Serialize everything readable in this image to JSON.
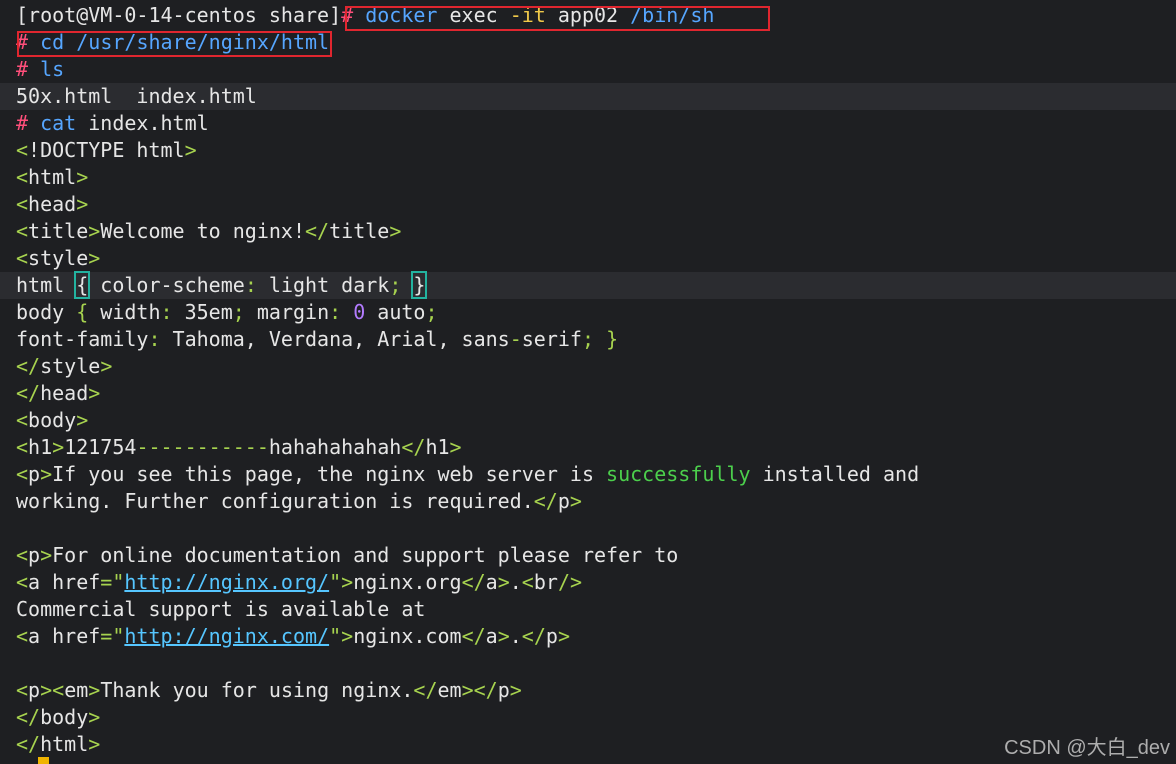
{
  "terminal": {
    "lines": [
      {
        "segments": [
          {
            "t": "[root@VM-0-14-centos share]",
            "c": "prompt"
          },
          {
            "t": "# ",
            "c": "hash"
          },
          {
            "t": "docker",
            "c": "cmd"
          },
          {
            "t": " exec ",
            "c": "plain"
          },
          {
            "t": "-it",
            "c": "arg"
          },
          {
            "t": " app02 ",
            "c": "plain"
          },
          {
            "t": "/bin/sh",
            "c": "cmd"
          }
        ]
      },
      {
        "segments": [
          {
            "t": "# ",
            "c": "hash"
          },
          {
            "t": "cd",
            "c": "cmd"
          },
          {
            "t": " ",
            "c": "plain"
          },
          {
            "t": "/usr/share/nginx/html",
            "c": "cmd"
          }
        ]
      },
      {
        "segments": [
          {
            "t": "# ",
            "c": "hash"
          },
          {
            "t": "ls",
            "c": "cmd"
          }
        ]
      },
      {
        "highlight": true,
        "segments": [
          {
            "t": "50x.html  index.html",
            "c": "plain"
          }
        ]
      },
      {
        "segments": [
          {
            "t": "# ",
            "c": "hash"
          },
          {
            "t": "cat",
            "c": "cmd"
          },
          {
            "t": " index.html",
            "c": "plain"
          }
        ]
      },
      {
        "segments": [
          {
            "t": "<",
            "c": "tag"
          },
          {
            "t": "!DOCTYPE html",
            "c": "plain"
          },
          {
            "t": ">",
            "c": "tag"
          }
        ]
      },
      {
        "segments": [
          {
            "t": "<",
            "c": "tag"
          },
          {
            "t": "html",
            "c": "plain"
          },
          {
            "t": ">",
            "c": "tag"
          }
        ]
      },
      {
        "segments": [
          {
            "t": "<",
            "c": "tag"
          },
          {
            "t": "head",
            "c": "plain"
          },
          {
            "t": ">",
            "c": "tag"
          }
        ]
      },
      {
        "segments": [
          {
            "t": "<",
            "c": "tag"
          },
          {
            "t": "title",
            "c": "plain"
          },
          {
            "t": ">",
            "c": "tag"
          },
          {
            "t": "Welcome to nginx!",
            "c": "plain"
          },
          {
            "t": "</",
            "c": "tag"
          },
          {
            "t": "title",
            "c": "plain"
          },
          {
            "t": ">",
            "c": "tag"
          }
        ]
      },
      {
        "segments": [
          {
            "t": "<",
            "c": "tag"
          },
          {
            "t": "style",
            "c": "plain"
          },
          {
            "t": ">",
            "c": "tag"
          }
        ]
      },
      {
        "highlight": true,
        "segments": [
          {
            "t": "html ",
            "c": "plain"
          },
          {
            "t": "{",
            "c": "bracket"
          },
          {
            "t": " color-scheme",
            "c": "plain"
          },
          {
            "t": ":",
            "c": "tag"
          },
          {
            "t": " light dark",
            "c": "plain"
          },
          {
            "t": ";",
            "c": "tag"
          },
          {
            "t": " ",
            "c": "plain"
          },
          {
            "t": "}",
            "c": "bracket"
          }
        ]
      },
      {
        "segments": [
          {
            "t": "body ",
            "c": "plain"
          },
          {
            "t": "{",
            "c": "tag"
          },
          {
            "t": " width",
            "c": "plain"
          },
          {
            "t": ":",
            "c": "tag"
          },
          {
            "t": " 35em",
            "c": "plain"
          },
          {
            "t": ";",
            "c": "tag"
          },
          {
            "t": " margin",
            "c": "plain"
          },
          {
            "t": ":",
            "c": "tag"
          },
          {
            "t": " ",
            "c": "plain"
          },
          {
            "t": "0",
            "c": "num"
          },
          {
            "t": " auto",
            "c": "plain"
          },
          {
            "t": ";",
            "c": "tag"
          }
        ]
      },
      {
        "segments": [
          {
            "t": "font-family",
            "c": "plain"
          },
          {
            "t": ":",
            "c": "tag"
          },
          {
            "t": " Tahoma, Verdana, Arial, sans",
            "c": "plain"
          },
          {
            "t": "-",
            "c": "tag"
          },
          {
            "t": "serif",
            "c": "plain"
          },
          {
            "t": ";",
            "c": "tag"
          },
          {
            "t": " ",
            "c": "plain"
          },
          {
            "t": "}",
            "c": "tag"
          }
        ]
      },
      {
        "segments": [
          {
            "t": "</",
            "c": "tag"
          },
          {
            "t": "style",
            "c": "plain"
          },
          {
            "t": ">",
            "c": "tag"
          }
        ]
      },
      {
        "segments": [
          {
            "t": "</",
            "c": "tag"
          },
          {
            "t": "head",
            "c": "plain"
          },
          {
            "t": ">",
            "c": "tag"
          }
        ]
      },
      {
        "segments": [
          {
            "t": "<",
            "c": "tag"
          },
          {
            "t": "body",
            "c": "plain"
          },
          {
            "t": ">",
            "c": "tag"
          }
        ]
      },
      {
        "segments": [
          {
            "t": "<",
            "c": "tag"
          },
          {
            "t": "h1",
            "c": "plain"
          },
          {
            "t": ">",
            "c": "tag"
          },
          {
            "t": "121754",
            "c": "plain"
          },
          {
            "t": "-----------",
            "c": "tag"
          },
          {
            "t": "hahahahahah",
            "c": "plain"
          },
          {
            "t": "</",
            "c": "tag"
          },
          {
            "t": "h1",
            "c": "plain"
          },
          {
            "t": ">",
            "c": "tag"
          }
        ]
      },
      {
        "segments": [
          {
            "t": "<",
            "c": "tag"
          },
          {
            "t": "p",
            "c": "plain"
          },
          {
            "t": ">",
            "c": "tag"
          },
          {
            "t": "If you see this page, the nginx web server is ",
            "c": "plain"
          },
          {
            "t": "successfully",
            "c": "ok"
          },
          {
            "t": " installed and",
            "c": "plain"
          }
        ]
      },
      {
        "segments": [
          {
            "t": "working. Further configuration is required.",
            "c": "plain"
          },
          {
            "t": "</",
            "c": "tag"
          },
          {
            "t": "p",
            "c": "plain"
          },
          {
            "t": ">",
            "c": "tag"
          }
        ]
      },
      {
        "segments": []
      },
      {
        "segments": [
          {
            "t": "<",
            "c": "tag"
          },
          {
            "t": "p",
            "c": "plain"
          },
          {
            "t": ">",
            "c": "tag"
          },
          {
            "t": "For online documentation and support please refer to",
            "c": "plain"
          }
        ]
      },
      {
        "segments": [
          {
            "t": "<",
            "c": "tag"
          },
          {
            "t": "a href",
            "c": "plain"
          },
          {
            "t": "=\"",
            "c": "tag"
          },
          {
            "t": "http://nginx.org/",
            "c": "link"
          },
          {
            "t": "\">",
            "c": "tag"
          },
          {
            "t": "nginx.org",
            "c": "plain"
          },
          {
            "t": "</",
            "c": "tag"
          },
          {
            "t": "a",
            "c": "plain"
          },
          {
            "t": ">",
            "c": "tag"
          },
          {
            "t": ".",
            "c": "plain"
          },
          {
            "t": "<",
            "c": "tag"
          },
          {
            "t": "br",
            "c": "plain"
          },
          {
            "t": "/>",
            "c": "tag"
          }
        ]
      },
      {
        "segments": [
          {
            "t": "Commercial support is available at",
            "c": "plain"
          }
        ]
      },
      {
        "segments": [
          {
            "t": "<",
            "c": "tag"
          },
          {
            "t": "a href",
            "c": "plain"
          },
          {
            "t": "=\"",
            "c": "tag"
          },
          {
            "t": "http://nginx.com/",
            "c": "link"
          },
          {
            "t": "\">",
            "c": "tag"
          },
          {
            "t": "nginx.com",
            "c": "plain"
          },
          {
            "t": "</",
            "c": "tag"
          },
          {
            "t": "a",
            "c": "plain"
          },
          {
            "t": ">",
            "c": "tag"
          },
          {
            "t": ".",
            "c": "plain"
          },
          {
            "t": "</",
            "c": "tag"
          },
          {
            "t": "p",
            "c": "plain"
          },
          {
            "t": ">",
            "c": "tag"
          }
        ]
      },
      {
        "segments": []
      },
      {
        "segments": [
          {
            "t": "<",
            "c": "tag"
          },
          {
            "t": "p",
            "c": "plain"
          },
          {
            "t": "><",
            "c": "tag"
          },
          {
            "t": "em",
            "c": "plain"
          },
          {
            "t": ">",
            "c": "tag"
          },
          {
            "t": "Thank you for using nginx.",
            "c": "plain"
          },
          {
            "t": "</",
            "c": "tag"
          },
          {
            "t": "em",
            "c": "plain"
          },
          {
            "t": "></",
            "c": "tag"
          },
          {
            "t": "p",
            "c": "plain"
          },
          {
            "t": ">",
            "c": "tag"
          }
        ]
      },
      {
        "segments": [
          {
            "t": "</",
            "c": "tag"
          },
          {
            "t": "body",
            "c": "plain"
          },
          {
            "t": ">",
            "c": "tag"
          }
        ]
      },
      {
        "segments": [
          {
            "t": "</",
            "c": "tag"
          },
          {
            "t": "html",
            "c": "plain"
          },
          {
            "t": ">",
            "c": "tag"
          }
        ]
      }
    ]
  },
  "watermark": "CSDN @大白_dev",
  "colors": {
    "background": "#1e1f22",
    "prompt_hash": "#ff4f7b",
    "command": "#56a6ff",
    "flag": "#f0c94a",
    "tag": "#a7d34f",
    "number": "#b37bff",
    "success_word": "#4ccf4c",
    "link": "#56c6ff",
    "annotation_box": "#e0262f",
    "cursor": "#f0b400"
  }
}
